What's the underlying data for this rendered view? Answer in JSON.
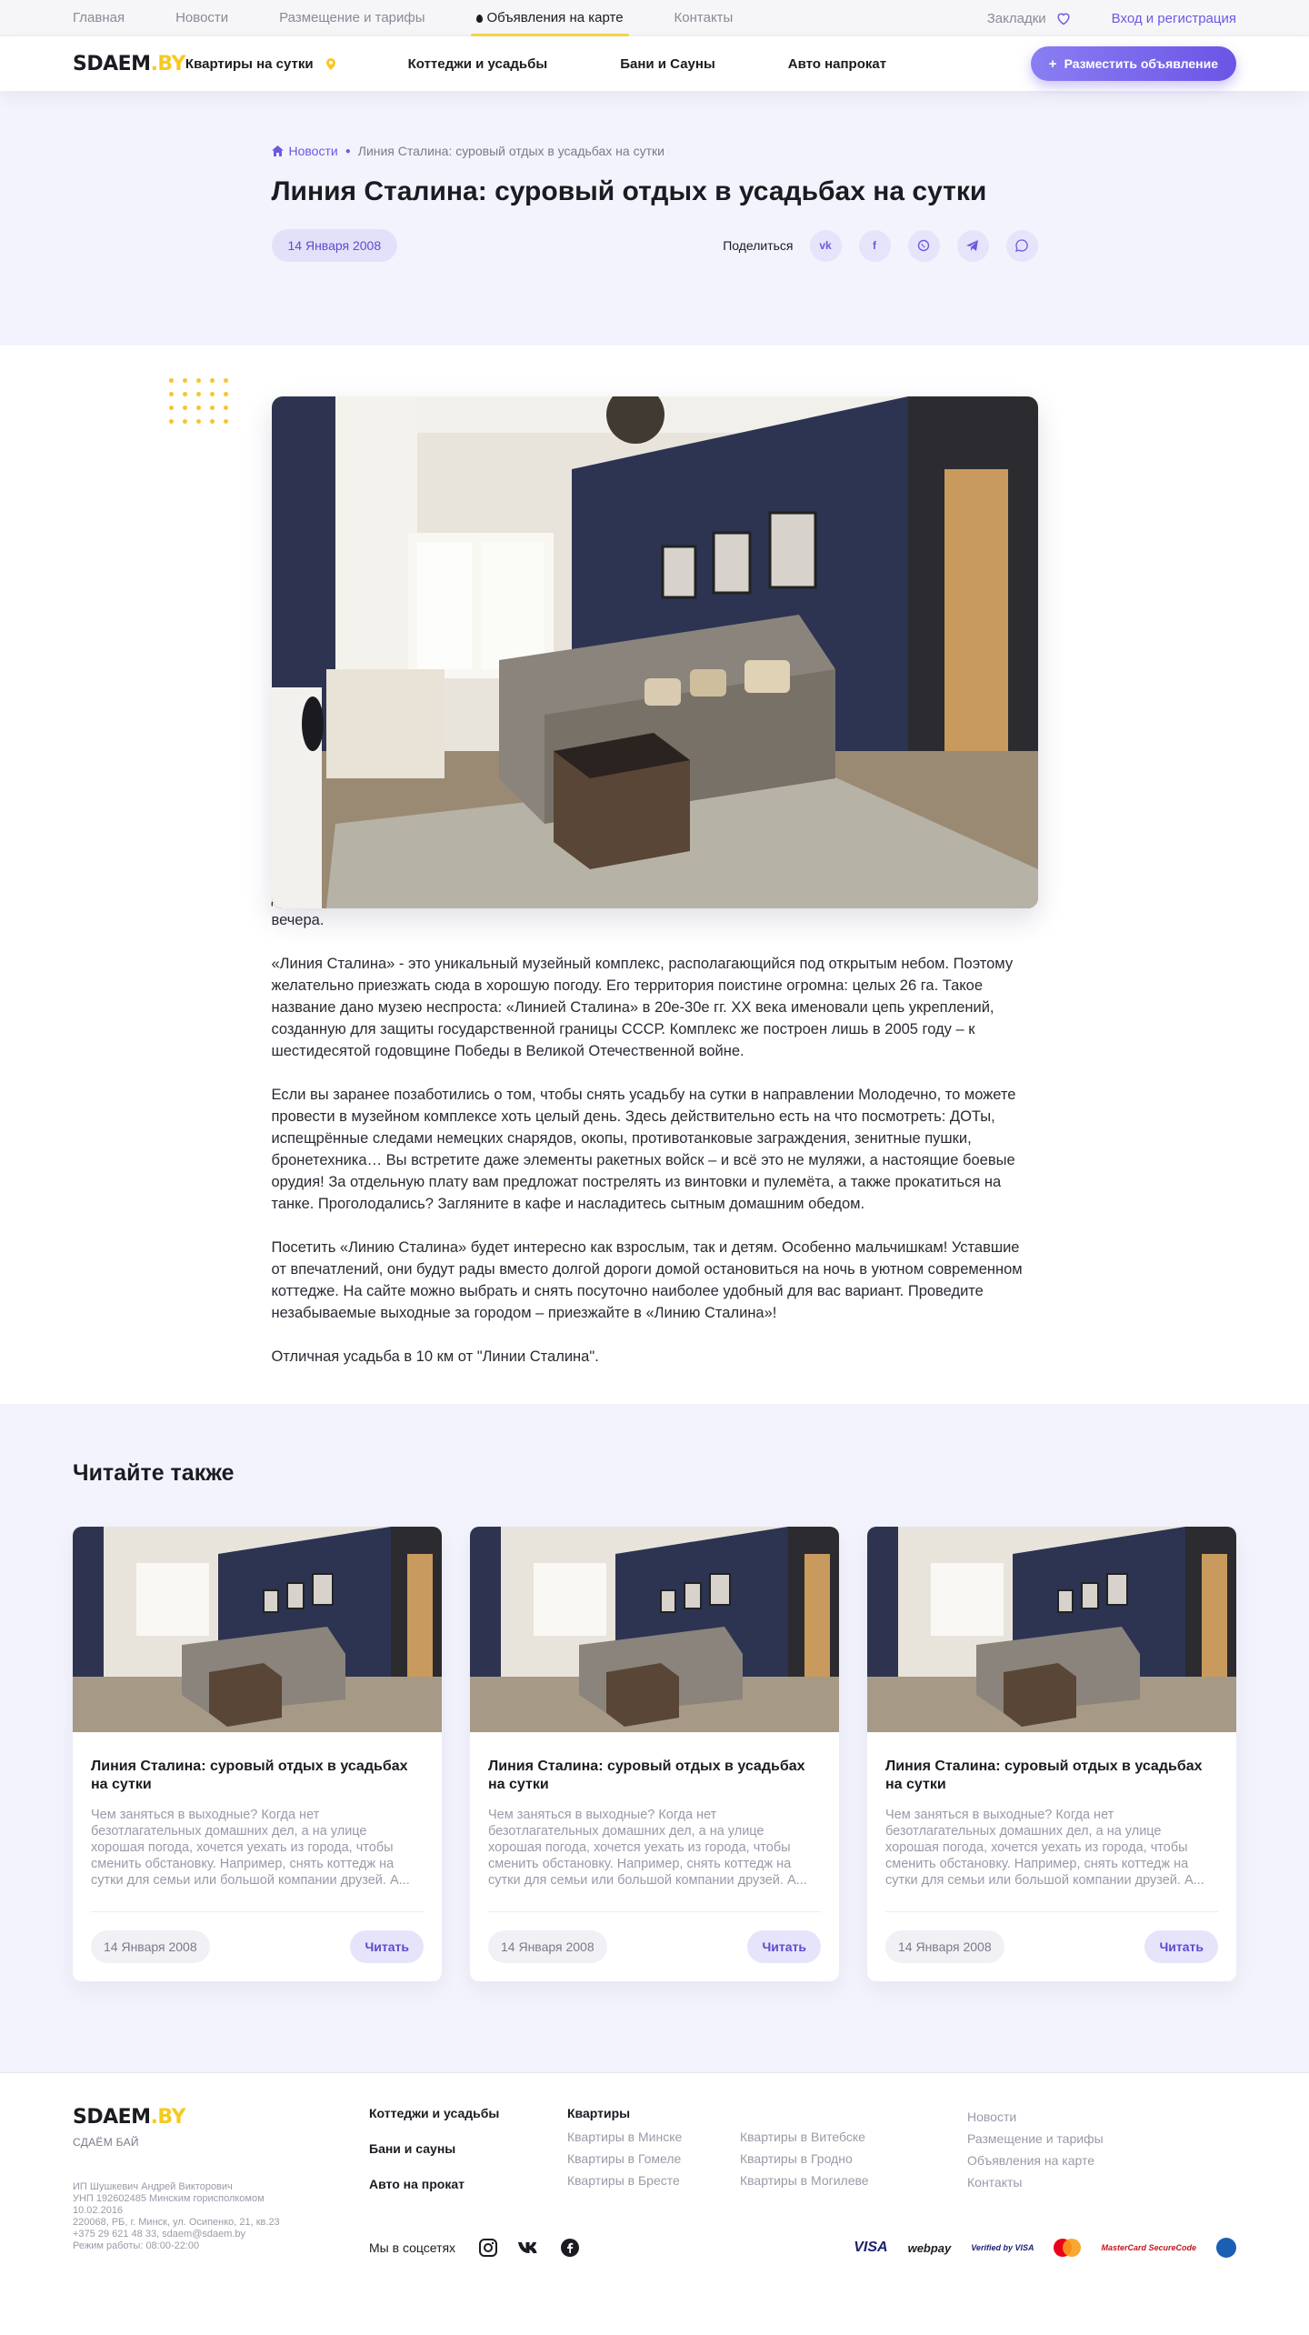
{
  "topbar": {
    "links": [
      "Главная",
      "Новости",
      "Размещение и тарифы",
      "Объявления на карте",
      "Контакты"
    ],
    "bookmarks": "Закладки",
    "login": "Вход и регистрация"
  },
  "nav": {
    "logo_main": "SDAEM",
    "logo_by": ".BY",
    "links": [
      "Квартиры на сутки",
      "Коттеджи и усадьбы",
      "Бани и Сауны",
      "Авто напрокат"
    ],
    "cta": "Разместить объявление",
    "cta_icon": "+"
  },
  "breadcrumb": {
    "home": "Новости",
    "current": "Линия Сталина: суровый отдых в усадьбах на сутки"
  },
  "article": {
    "title": "Линия Сталина: суровый отдых в усадьбах на сутки",
    "date": "14 Января 2008",
    "share_label": "Поделиться",
    "share_icons": [
      "vk-icon",
      "facebook-icon",
      "viber-icon",
      "telegram-icon",
      "whatsapp-icon"
    ],
    "paragraphs": [
      "Итак, утром вы выезжаете в путь по Молодеченской трассе. Если автомобиля у вас нет - садитесь на маршрутку в сторону Молодечно от железнодорожного вокзала. Остановка называется «Линия Сталина» - да-да, именно здесь вы и проведёте ближайшие несколько часов, а вероятнее всего – останетесь до самого вечера.",
      "«Линия Сталина» - это уникальный музейный комплекс, располагающийся под открытым небом. Поэтому желательно приезжать сюда в хорошую погоду. Его территория поистине огромна: целых 26 га. Такое название дано музею неспроста: «Линией Сталина» в 20е-30е гг. XX века именовали цепь укреплений, созданную для защиты государственной границы СССР. Комплекс же построен лишь в 2005 году – к шестидесятой годовщине Победы в Великой Отечественной войне.",
      "Если вы заранее позаботились о том, чтобы снять усадьбу на сутки в направлении Молодечно, то можете провести в музейном комплексе хоть целый день. Здесь действительно есть на что посмотреть: ДОТы, испещрённые следами немецких снарядов, окопы, противотанковые заграждения, зенитные пушки, бронетехника… Вы встретите даже элементы ракетных войск – и всё это не муляжи, а настоящие боевые орудия! За отдельную плату вам предложат пострелять из винтовки и пулемёта, а также прокатиться на танке. Проголодались? Загляните в кафе и насладитесь сытным домашним обедом.",
      "Посетить «Линию Сталина» будет интересно как взрослым, так и детям. Особенно мальчишкам! Уставшие от впечатлений, они будут рады вместо долгой дороги домой остановиться на ночь в уютном современном коттедже. На сайте можно выбрать и снять посуточно наиболее удобный для вас вариант. Проведите незабываемые выходные за городом – приезжайте в «Линию Сталина»!",
      "Отличная усадьба в 10 км от \"Линии Сталина\"."
    ]
  },
  "read_also": {
    "heading": "Читайте также",
    "cards": [
      {
        "title": "Линия Сталина: суровый отдых в усадьбах на сутки",
        "desc": "Чем заняться в выходные? Когда нет безотлагательных домашних дел, а на улице хорошая погода, хочется уехать из города, чтобы сменить обстановку. Например, снять коттедж на сутки для семьи или большой компании друзей. А...",
        "date": "14 Января 2008",
        "read": "Читать"
      },
      {
        "title": "Линия Сталина: суровый отдых в усадьбах на сутки",
        "desc": "Чем заняться в выходные? Когда нет безотлагательных домашних дел, а на улице хорошая погода, хочется уехать из города, чтобы сменить обстановку. Например, снять коттедж на сутки для семьи или большой компании друзей. А...",
        "date": "14 Января 2008",
        "read": "Читать"
      },
      {
        "title": "Линия Сталина: суровый отдых в усадьбах на сутки",
        "desc": "Чем заняться в выходные? Когда нет безотлагательных домашних дел, а на улице хорошая погода, хочется уехать из города, чтобы сменить обстановку. Например, снять коттедж на сутки для семьи или большой компании друзей. А...",
        "date": "14 Января 2008",
        "read": "Читать"
      }
    ]
  },
  "footer": {
    "logo_main": "SDAEM",
    "logo_by": ".BY",
    "subtitle": "СДАЁМ БАЙ",
    "legal": [
      "ИП Шушкевич Андрей Викторович",
      "УНП 192602485 Минским горисполкомом",
      "10.02.2016",
      "220068, РБ, г. Минск, ул. Осипенко, 21, кв.23",
      "+375 29 621 48 33, sdaem@sdaem.by",
      "Режим работы: 08:00-22:00"
    ],
    "col1": [
      "Коттеджи и усадьбы",
      "Бани и сауны",
      "Авто на прокат"
    ],
    "apartments_heading": "Квартиры",
    "apartments": [
      "Квартиры в Минске",
      "Квартиры в Витебске",
      "Квартиры в Гомеле",
      "Квартиры в Гродно",
      "Квартиры в Бресте",
      "Квартиры в Могилеве"
    ],
    "col3": [
      "Новости",
      "Размещение и тарифы",
      "Объявления на карте",
      "Контакты"
    ],
    "social_label": "Мы в соцсетях",
    "payments": [
      "VISA",
      "webpay",
      "Verified by VISA",
      "MasterCard SecureCode"
    ]
  },
  "colors": {
    "accent": "#6a5ae0",
    "brand_yellow": "#f7c91e",
    "hero_bg": "#f3f3fd"
  }
}
